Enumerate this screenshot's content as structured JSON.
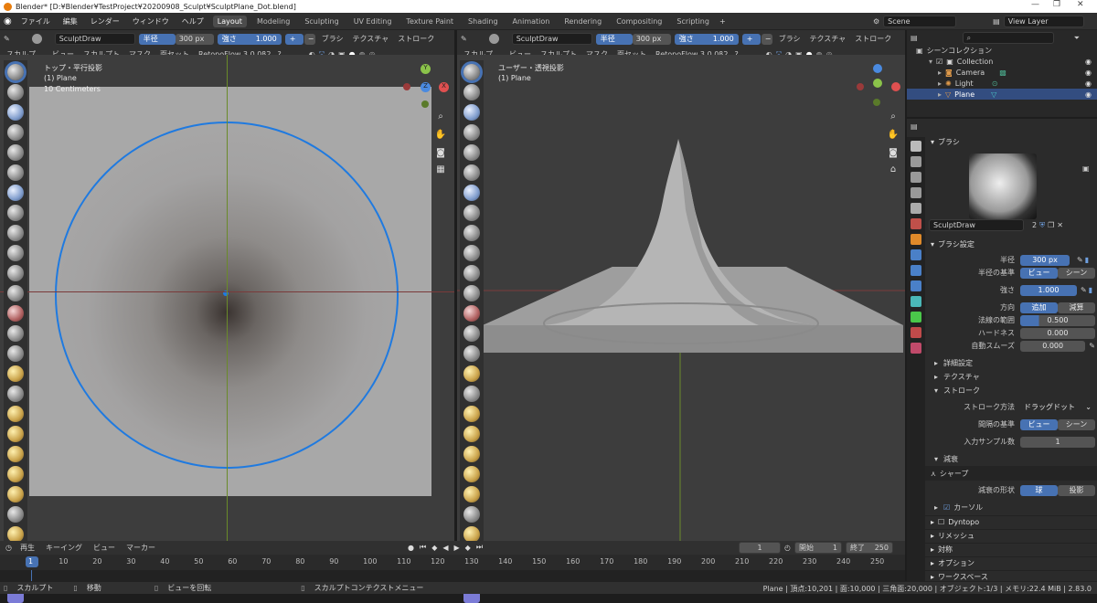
{
  "title_bar": {
    "text": "Blender* [D:¥Blender¥TestProject¥20200908_Sculpt¥SculptPlane_Dot.blend]"
  },
  "menu": [
    "ファイル",
    "編集",
    "レンダー",
    "ウィンドウ",
    "ヘルプ"
  ],
  "workspace_tabs": [
    "Layout",
    "Modeling",
    "Sculpting",
    "UV Editing",
    "Texture Paint",
    "Shading",
    "Animation",
    "Rendering",
    "Compositing",
    "Scripting"
  ],
  "active_workspace": "Layout",
  "scene": {
    "label": "Scene",
    "view_layer": "View Layer"
  },
  "tool_header": {
    "brush_name": "SculptDraw",
    "radius_label": "半径",
    "radius_value": "300 px",
    "strength_label": "強さ",
    "strength_value": "1.000",
    "brush_menu": "ブラシ",
    "texture_menu": "テクスチャ",
    "stroke_menu": "ストローク",
    "mode": "スカルプ…",
    "view_menu": "ビュー",
    "sculpt_menu": "スカルプト",
    "mask_menu": "マスク",
    "face_sets_menu": "面セット",
    "addon": "RetopoFlow 3.0.0β2"
  },
  "viewport_left": {
    "view_name": "トップ・平行投影",
    "object": "(1) Plane",
    "scale": "10 Centimeters"
  },
  "viewport_right": {
    "view_name": "ユーザー・透視投影",
    "object": "(1) Plane"
  },
  "gizmo": {
    "x": "X",
    "y": "Y",
    "z": "Z"
  },
  "outliner": {
    "root": "シーンコレクション",
    "items": [
      {
        "name": "Collection"
      },
      {
        "name": "Camera"
      },
      {
        "name": "Light"
      },
      {
        "name": "Plane"
      }
    ]
  },
  "properties": {
    "brush_section": "ブラシ",
    "brush_name": "SculptDraw",
    "brush_users": "2",
    "brush_settings_section": "ブラシ設定",
    "radius_label": "半径",
    "radius_value": "300 px",
    "radius_unit_label": "半径の基準",
    "radius_unit_view": "ビュー",
    "radius_unit_scene": "シーン",
    "strength_label": "強さ",
    "strength_value": "1.000",
    "direction_label": "方向",
    "direction_add": "追加",
    "direction_sub": "減算",
    "normal_radius_label": "法線の範囲",
    "normal_radius_value": "0.500",
    "hardness_label": "ハードネス",
    "hardness_value": "0.000",
    "autosmooth_label": "自動スムーズ",
    "autosmooth_value": "0.000",
    "advanced": "詳細設定",
    "texture": "テクスチャ",
    "stroke": "ストローク",
    "stroke_method_label": "ストローク方法",
    "stroke_method_value": "ドラッグドット",
    "spacing_label": "間隔の基準",
    "spacing_view": "ビュー",
    "spacing_scene": "シーン",
    "input_samples_label": "入力サンプル数",
    "input_samples_value": "1",
    "falloff": "減衰",
    "falloff_preset": "シャープ",
    "falloff_shape_label": "減衰の形状",
    "falloff_shape_sphere": "球",
    "falloff_shape_proj": "投影",
    "cursor": "カーソル",
    "dyntopo": "Dyntopo",
    "remesh": "リメッシュ",
    "symmetry": "対称",
    "options": "オプション",
    "workspace": "ワークスペース"
  },
  "timeline": {
    "menus": [
      "再生",
      "キーイング",
      "ビュー",
      "マーカー"
    ],
    "current_frame": "1",
    "start_label": "開始",
    "start": "1",
    "end_label": "終了",
    "end": "250",
    "ticks": [
      "1",
      "10",
      "20",
      "30",
      "40",
      "50",
      "60",
      "70",
      "80",
      "90",
      "100",
      "110",
      "120",
      "130",
      "140",
      "150",
      "160",
      "170",
      "180",
      "190",
      "200",
      "210",
      "220",
      "230",
      "240",
      "250"
    ]
  },
  "status": {
    "left": [
      "スカルプト",
      "移動",
      "ビューを回転",
      "スカルプトコンテクストメニュー"
    ],
    "right": "Plane | 頂点:10,201 | 面:10,000 | 三角面:20,000 | オブジェクト:1/3 | メモリ:22.4 MiB | 2.83.0"
  },
  "colors": {
    "accent": "#4772b3",
    "circle": "#1f7ae0"
  }
}
